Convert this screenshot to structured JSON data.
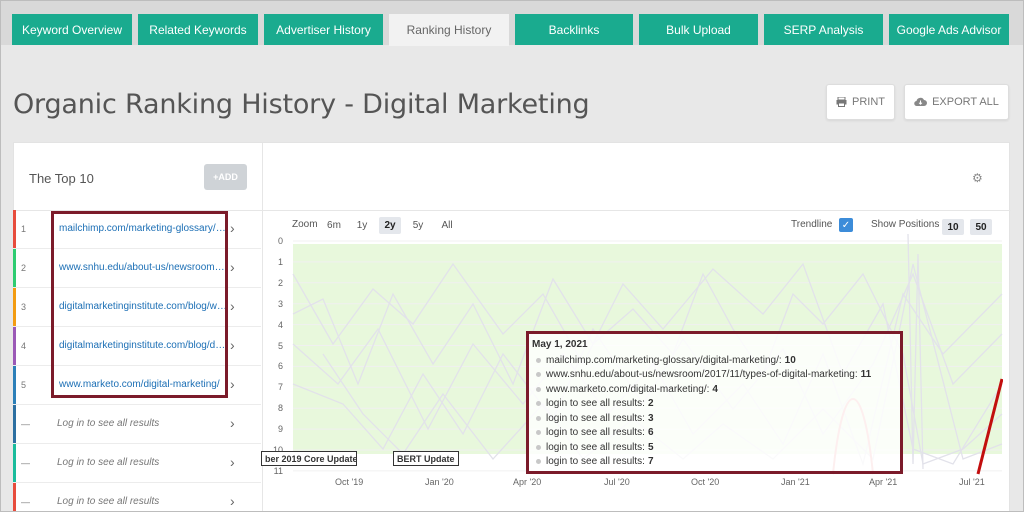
{
  "tabs": [
    {
      "label": "Keyword Overview"
    },
    {
      "label": "Related Keywords"
    },
    {
      "label": "Advertiser History"
    },
    {
      "label": "Ranking History"
    },
    {
      "label": "Backlinks"
    },
    {
      "label": "Bulk Upload"
    },
    {
      "label": "SERP Analysis"
    },
    {
      "label": "Google Ads Advisor"
    }
  ],
  "page": {
    "title": "Organic Ranking History - Digital Marketing",
    "print_label": "PRINT",
    "export_label": "EXPORT ALL"
  },
  "panel": {
    "heading": "The Top 10",
    "add_label": "+ADD",
    "ranks": [
      {
        "num": "1",
        "url": "mailchimp.com/marketing-glossary/digital-marketing/",
        "color": "#e74c3c"
      },
      {
        "num": "2",
        "url": "www.snhu.edu/about-us/newsroom/2017/11/types-of-digital-marketing",
        "color": "#2ecc71"
      },
      {
        "num": "3",
        "url": "digitalmarketinginstitute.com/blog/what-is-digital-marketing",
        "color": "#f39c12"
      },
      {
        "num": "4",
        "url": "digitalmarketinginstitute.com/blog/digital-marketing",
        "color": "#9b59b6"
      },
      {
        "num": "5",
        "url": "www.marketo.com/digital-marketing/",
        "color": "#2c7fb8"
      },
      {
        "num": "—",
        "url": "Log in to see all results",
        "color": "#2c6fa1"
      },
      {
        "num": "—",
        "url": "Log in to see all results",
        "color": "#1abc9c"
      },
      {
        "num": "—",
        "url": "Log in to see all results",
        "color": "#e74c3c"
      }
    ]
  },
  "controls": {
    "zoom_label": "Zoom",
    "zoom_options": [
      "6m",
      "1y",
      "2y",
      "5y",
      "All"
    ],
    "zoom_selected": "2y",
    "trendline_label": "Trendline",
    "trendline_checked": true,
    "show_positions_label": "Show Positions",
    "positions": [
      "10",
      "50"
    ]
  },
  "chart_data": {
    "type": "line",
    "y_ticks": [
      "0",
      "1",
      "2",
      "3",
      "4",
      "5",
      "6",
      "7",
      "8",
      "9",
      "10",
      "11"
    ],
    "x_ticks": [
      "Oct '19",
      "Jan '20",
      "Apr '20",
      "Jul '20",
      "Oct '20",
      "Jan '21",
      "Apr '21",
      "Jul '21"
    ],
    "ylim": [
      0,
      11
    ],
    "y_reversed": true,
    "annotations": [
      "ber 2019 Core Update",
      "BERT Update"
    ],
    "colors": {
      "band": "#e8f8dc",
      "series_muted": "#e2e2ea",
      "highlight_red": "#c20e0e",
      "highlight_pink": "#f2a8a8"
    }
  },
  "tooltip": {
    "date": "May 1, 2021",
    "lines": [
      {
        "label": "mailchimp.com/marketing-glossary/digital-marketing/:",
        "value": "10"
      },
      {
        "label": "www.snhu.edu/about-us/newsroom/2017/11/types-of-digital-marketing:",
        "value": "11"
      },
      {
        "label": "www.marketo.com/digital-marketing/:",
        "value": "4"
      },
      {
        "label": "login to see all results:",
        "value": "2"
      },
      {
        "label": "login to see all results:",
        "value": "3"
      },
      {
        "label": "login to see all results:",
        "value": "6"
      },
      {
        "label": "login to see all results:",
        "value": "5"
      },
      {
        "label": "login to see all results:",
        "value": "7"
      }
    ]
  },
  "theme": {
    "tab_green": "#1aab8f",
    "frame_red": "#7b1b2a",
    "link_blue": "#1c6fb5"
  }
}
